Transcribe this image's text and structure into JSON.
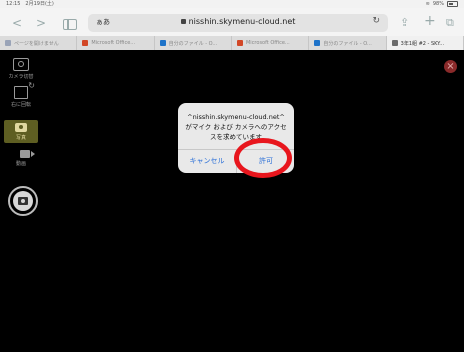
{
  "status_bar": {
    "time_date": "12:15　2月19日(土)",
    "battery": "98%"
  },
  "browser": {
    "address_prefix": "ぁあ",
    "url": "nisshin.skymenu-cloud.net",
    "tabs": [
      {
        "label": "ページを開けません",
        "favicon_color": "#9aa4b8"
      },
      {
        "label": "Microsoft Office...",
        "favicon_color": "#d24726"
      },
      {
        "label": "自分のファイル - O...",
        "favicon_color": "#1e73c9"
      },
      {
        "label": "Microsoft Office...",
        "favicon_color": "#d24726"
      },
      {
        "label": "自分のファイル - O...",
        "favicon_color": "#1e73c9"
      },
      {
        "label": "3年1組 #2 - SKY...",
        "favicon_color": "#6b6b6b"
      }
    ]
  },
  "camera_menu": {
    "switch_camera": "カメラ切替",
    "rotate_right": "右に回転",
    "photo": "写真",
    "video": "動画"
  },
  "dialog": {
    "message": "^nisshin.skymenu-cloud.net^がマイク および カメラへのアクセスを求めています",
    "cancel": "キャンセル",
    "allow": "許可"
  },
  "colors": {
    "accent": "#2a6fd8",
    "highlight": "#e8161d",
    "active_mode": "#5e5e22"
  }
}
